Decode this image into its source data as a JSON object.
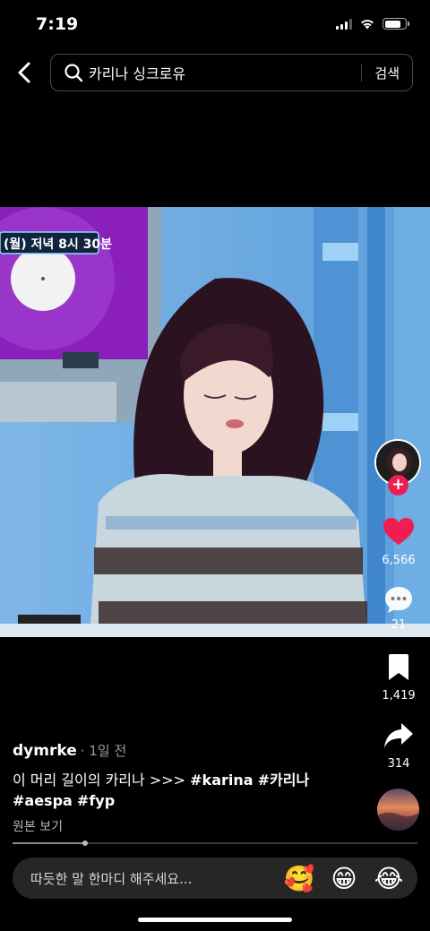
{
  "status_bar": {
    "time": "7:19",
    "signal_icon": "cellular-signal-icon",
    "wifi_icon": "wifi-icon",
    "battery_icon": "battery-icon"
  },
  "header": {
    "back_icon": "chevron-left-icon",
    "search_icon": "search-icon",
    "search_query": "카리나 싱크로유",
    "search_button": "검색"
  },
  "video": {
    "overlay_text": "(월) 저녁 8시 30분"
  },
  "actions": {
    "like_icon": "heart-icon",
    "likes": "6,566",
    "comment_icon": "comment-bubble-icon",
    "comments": "21",
    "bookmark_icon": "bookmark-icon",
    "bookmarks": "1,419",
    "share_icon": "share-arrow-icon",
    "shares": "314",
    "follow_icon": "plus-icon"
  },
  "post": {
    "username": "dymrke",
    "date": "· 1일 전",
    "caption_text": "이 머리 길이의 카리나 >>> ",
    "hashtags_line1": [
      "#karina",
      "#카리나"
    ],
    "hashtags_line2": [
      "#aespa",
      "#fyp"
    ],
    "see_original": "원본 보기",
    "progress": 0.18
  },
  "comment_bar": {
    "placeholder": "따듯한 말 한마디 해주세요...",
    "emojis": [
      "🥰",
      "😁",
      "😂"
    ]
  },
  "colors": {
    "like": "#ee1d52",
    "follow": "#ee1d52",
    "background": "#000000"
  }
}
